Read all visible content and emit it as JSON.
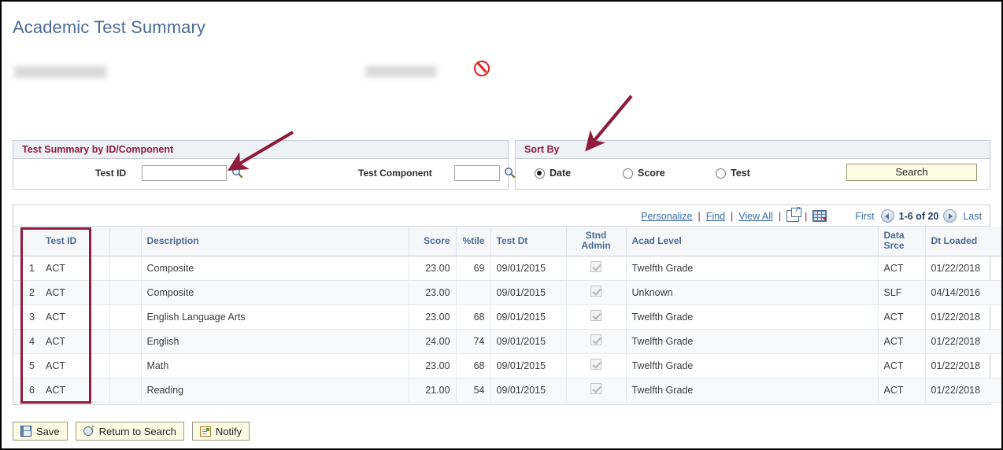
{
  "header": {
    "title": "Academic Test Summary",
    "redacted_name": "",
    "redacted_id": "",
    "status_icon": "prohibited-icon"
  },
  "search_panel": {
    "title": "Test Summary by ID/Component",
    "test_id_label": "Test ID",
    "test_id_value": "",
    "test_id_lookup_icon": "search-icon",
    "test_component_label": "Test Component",
    "test_component_value": "",
    "test_component_lookup_icon": "search-icon"
  },
  "sort_panel": {
    "title": "Sort By",
    "options": [
      {
        "label": "Date",
        "selected": true
      },
      {
        "label": "Score",
        "selected": false
      },
      {
        "label": "Test",
        "selected": false
      }
    ],
    "search_button": "Search"
  },
  "grid_nav": {
    "personalize": "Personalize",
    "find": "Find",
    "view_all": "View All",
    "sep": "|",
    "new_window_icon": "new-window-icon",
    "download_icon": "download-spreadsheet-icon",
    "first": "First",
    "counter": "1-6 of 20",
    "last": "Last",
    "prev_icon": "left-arrow-icon",
    "next_icon": "right-arrow-icon"
  },
  "table": {
    "columns": [
      {
        "key": "num",
        "label": ""
      },
      {
        "key": "tid",
        "label": "Test ID"
      },
      {
        "key": "gap",
        "label": ""
      },
      {
        "key": "desc",
        "label": "Description"
      },
      {
        "key": "score",
        "label": "Score"
      },
      {
        "key": "pct",
        "label": "%tile"
      },
      {
        "key": "date",
        "label": "Test Dt"
      },
      {
        "key": "stnd",
        "label": "Stnd\nAdmin"
      },
      {
        "key": "acad",
        "label": "Acad Level"
      },
      {
        "key": "src",
        "label": "Data\nSrce"
      },
      {
        "key": "load",
        "label": "Dt Loaded"
      }
    ],
    "header_stnd_line1": "Stnd",
    "header_stnd_line2": "Admin",
    "header_src_line1": "Data",
    "header_src_line2": "Srce",
    "rows": [
      {
        "num": "1",
        "tid": "ACT",
        "desc": "Composite",
        "score": "23.00",
        "pct": "69",
        "date": "09/01/2015",
        "stnd": true,
        "acad": "Twelfth Grade",
        "src": "ACT",
        "load": "01/22/2018"
      },
      {
        "num": "2",
        "tid": "ACT",
        "desc": "Composite",
        "score": "23.00",
        "pct": "",
        "date": "09/01/2015",
        "stnd": true,
        "acad": "Unknown",
        "src": "SLF",
        "load": "04/14/2016"
      },
      {
        "num": "3",
        "tid": "ACT",
        "desc": "English Language Arts",
        "score": "23.00",
        "pct": "68",
        "date": "09/01/2015",
        "stnd": true,
        "acad": "Twelfth Grade",
        "src": "ACT",
        "load": "01/22/2018"
      },
      {
        "num": "4",
        "tid": "ACT",
        "desc": "English",
        "score": "24.00",
        "pct": "74",
        "date": "09/01/2015",
        "stnd": true,
        "acad": "Twelfth Grade",
        "src": "ACT",
        "load": "01/22/2018"
      },
      {
        "num": "5",
        "tid": "ACT",
        "desc": "Math",
        "score": "23.00",
        "pct": "68",
        "date": "09/01/2015",
        "stnd": true,
        "acad": "Twelfth Grade",
        "src": "ACT",
        "load": "01/22/2018"
      },
      {
        "num": "6",
        "tid": "ACT",
        "desc": "Reading",
        "score": "21.00",
        "pct": "54",
        "date": "09/01/2015",
        "stnd": true,
        "acad": "Twelfth Grade",
        "src": "ACT",
        "load": "01/22/2018"
      }
    ]
  },
  "footer": {
    "save": "Save",
    "return_to_search": "Return to Search",
    "notify": "Notify"
  },
  "annotations": {
    "accent_color": "#8f1c3c",
    "arrow_to_test_id": "arrow pointing to Test ID lookup",
    "arrow_to_sort_by": "arrow pointing to Sort By panel",
    "rect_on_test_id_column": "highlight rectangle on Test ID column"
  }
}
